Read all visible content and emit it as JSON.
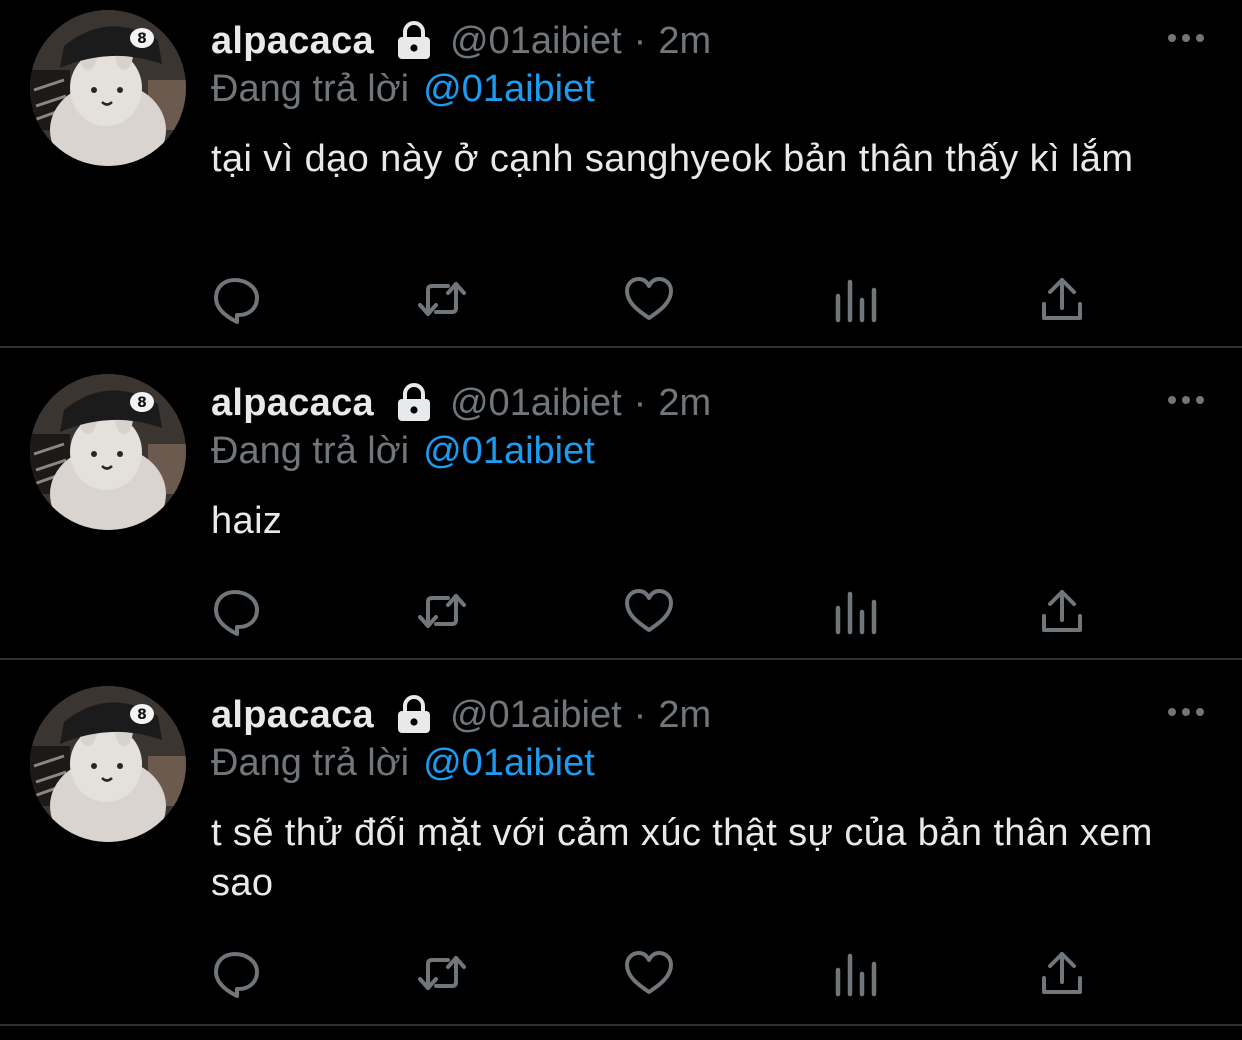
{
  "icons": {
    "lock": "lock-icon",
    "more": "more-horizontal-icon",
    "reply": "reply-bubble-icon",
    "retweet": "retweet-icon",
    "like": "heart-icon",
    "views": "bar-chart-icon",
    "share": "share-upload-icon"
  },
  "colors": {
    "background": "#000000",
    "text_primary": "#e7e9ea",
    "text_secondary": "#71767b",
    "link": "#1d9bf0",
    "divider": "#2f3336"
  },
  "tweets": [
    {
      "display_name": "alpacaca",
      "handle": "@01aibiet",
      "separator": "·",
      "time": "2m",
      "reply_prefix": "Đang trả lời",
      "reply_mention": "@01aibiet",
      "text": "tại vì dạo này ở cạnh sanghyeok bản thân thấy kì lắm"
    },
    {
      "display_name": "alpacaca",
      "handle": "@01aibiet",
      "separator": "·",
      "time": "2m",
      "reply_prefix": "Đang trả lời",
      "reply_mention": "@01aibiet",
      "text": "haiz"
    },
    {
      "display_name": "alpacaca",
      "handle": "@01aibiet",
      "separator": "·",
      "time": "2m",
      "reply_prefix": "Đang trả lời",
      "reply_mention": "@01aibiet",
      "text": "t sẽ thử đối mặt với cảm xúc thật sự của bản thân xem sao"
    }
  ]
}
